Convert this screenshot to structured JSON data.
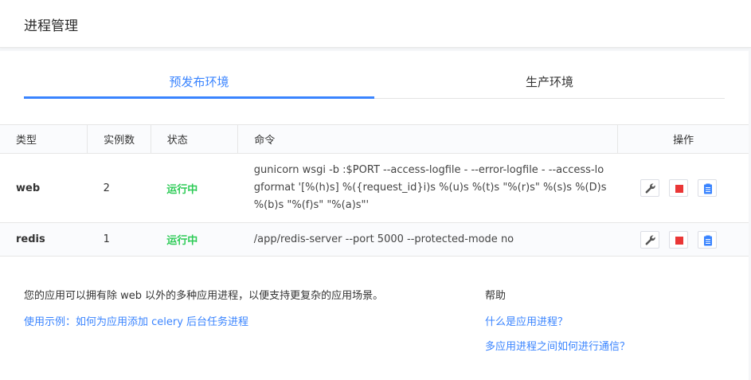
{
  "page": {
    "title": "进程管理"
  },
  "tabs": [
    {
      "label": "预发布环境",
      "active": true
    },
    {
      "label": "生产环境",
      "active": false
    }
  ],
  "table": {
    "headers": [
      "类型",
      "实例数",
      "状态",
      "命令",
      "操作"
    ],
    "rows": [
      {
        "type": "web",
        "instances": "2",
        "status": "运行中",
        "command": "gunicorn wsgi -b :$PORT --access-logfile - --error-logfile - --access-logformat '[%(h)s] %({request_id}i)s %(u)s %(t)s \"%(r)s\" %(s)s %(D)s %(b)s \"%(f)s\" \"%(a)s\"'"
      },
      {
        "type": "redis",
        "instances": "1",
        "status": "运行中",
        "command": "/app/redis-server --port 5000 --protected-mode no"
      }
    ],
    "ops_icons": [
      "wrench-icon",
      "stop-icon",
      "clipboard-icon"
    ]
  },
  "footer": {
    "intro": "您的应用可以拥有除 web 以外的多种应用进程，以便支持更复杂的应用场景。",
    "example_link": "使用示例：如何为应用添加 celery 后台任务进程",
    "help_title": "帮助",
    "help_links": [
      "什么是应用进程？",
      "多应用进程之间如何进行通信？"
    ]
  },
  "colors": {
    "accent": "#3a84ff",
    "running": "#2dcb56",
    "stop": "#ea3636"
  }
}
